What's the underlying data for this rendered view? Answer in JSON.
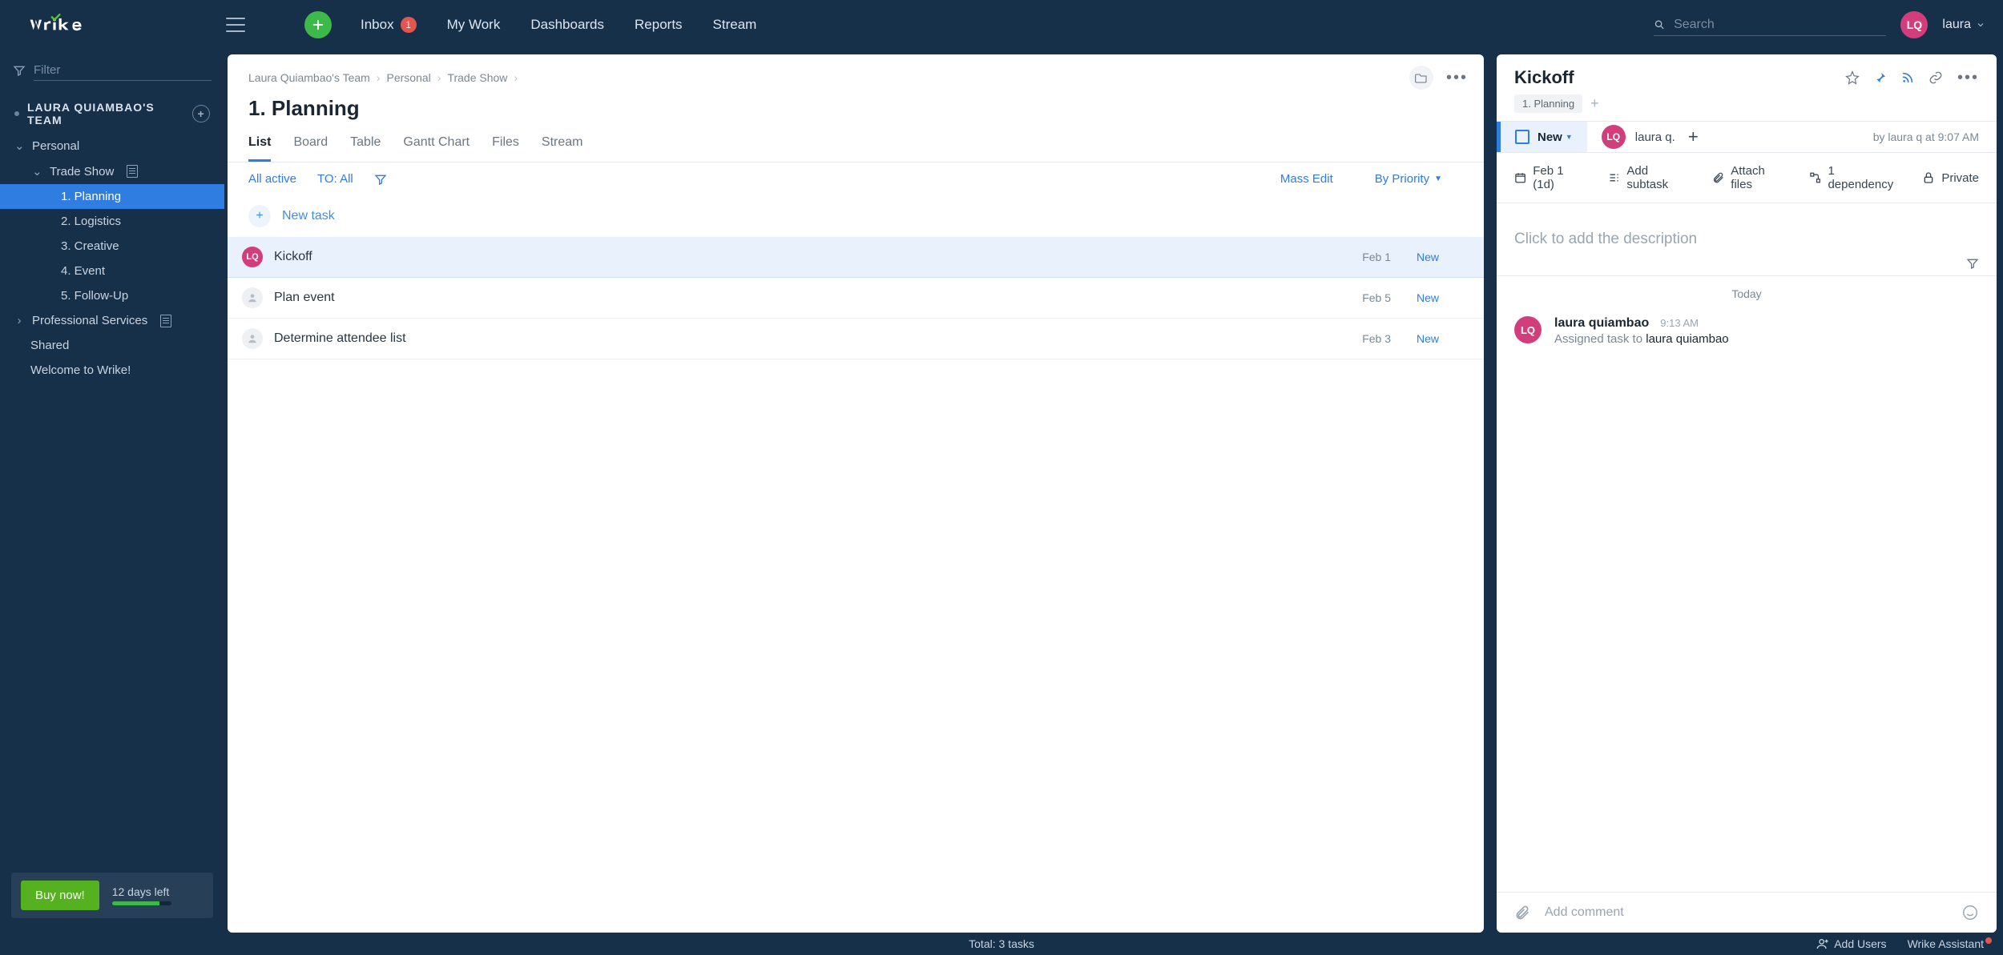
{
  "app": {
    "name": "Wrike"
  },
  "topbar": {
    "nav": [
      {
        "label": "Inbox",
        "badge": "1"
      },
      {
        "label": "My Work"
      },
      {
        "label": "Dashboards"
      },
      {
        "label": "Reports"
      },
      {
        "label": "Stream"
      }
    ],
    "search_placeholder": "Search",
    "user_initials": "LQ",
    "user_label": "laura"
  },
  "sidebar": {
    "filter_placeholder": "Filter",
    "team_header": "LAURA QUIAMBAO'S TEAM",
    "items": {
      "personal": "Personal",
      "trade_show": "Trade Show",
      "planning": "1. Planning",
      "logistics": "2. Logistics",
      "creative": "3. Creative",
      "event": "4. Event",
      "followup": "5. Follow-Up",
      "prof_services": "Professional Services",
      "shared": "Shared",
      "welcome": "Welcome to Wrike!"
    },
    "buy_now": "Buy now!",
    "trial_text": "12 days left"
  },
  "center": {
    "breadcrumbs": [
      "Laura Quiambao's Team",
      "Personal",
      "Trade Show"
    ],
    "title": "1. Planning",
    "tabs": [
      "List",
      "Board",
      "Table",
      "Gantt Chart",
      "Files",
      "Stream"
    ],
    "toolbar": {
      "all_active": "All active",
      "to_all": "TO: All",
      "mass_edit": "Mass Edit",
      "by_priority": "By Priority"
    },
    "new_task": "New task",
    "tasks": [
      {
        "initials": "LQ",
        "title": "Kickoff",
        "date": "Feb 1",
        "status": "New",
        "assigned": true,
        "selected": true
      },
      {
        "initials": "",
        "title": "Plan event",
        "date": "Feb 5",
        "status": "New",
        "assigned": false,
        "selected": false
      },
      {
        "initials": "",
        "title": "Determine attendee list",
        "date": "Feb 3",
        "status": "New",
        "assigned": false,
        "selected": false
      }
    ]
  },
  "right": {
    "title": "Kickoff",
    "tag": "1. Planning",
    "status_label": "New",
    "assignee_initials": "LQ",
    "assignee_name": "laura q.",
    "byline": "by laura q at 9:07 AM",
    "actions": {
      "date": "Feb 1 (1d)",
      "subtask": "Add subtask",
      "attach": "Attach files",
      "dependency": "1 dependency",
      "private": "Private"
    },
    "desc_placeholder": "Click to add the description",
    "activity_header": "Today",
    "activity": {
      "initials": "LQ",
      "name": "laura quiambao",
      "time": "9:13 AM",
      "text_prefix": "Assigned task to ",
      "text_subject": "laura quiambao"
    },
    "comment_placeholder": "Add comment"
  },
  "bottom": {
    "total": "Total: 3 tasks",
    "add_users": "Add Users",
    "assistant": "Wrike Assistant"
  }
}
